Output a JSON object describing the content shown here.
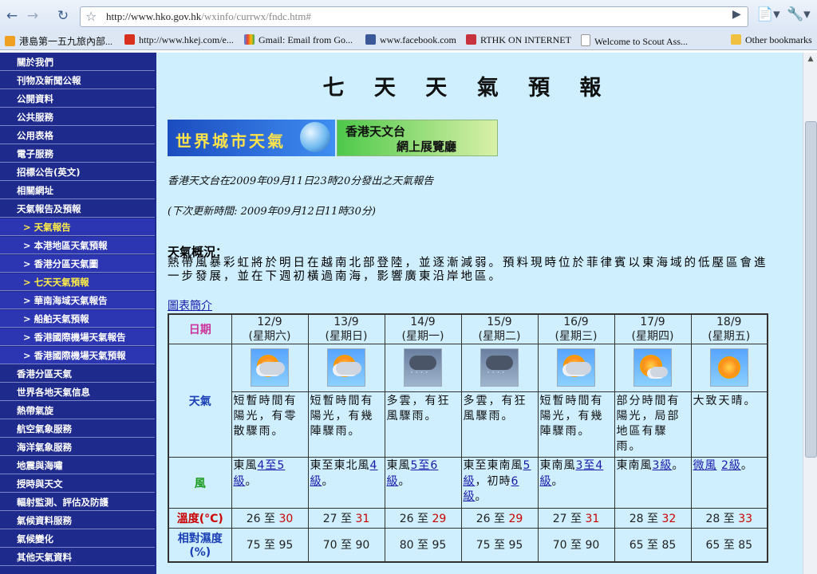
{
  "browser": {
    "url_host": "http://www.hko.gov.hk",
    "url_path": "/wxinfo/currwx/fndc.htm#",
    "bookmarks": [
      "港島第一五九旅內部...",
      "http://www.hkej.com/e...",
      "Gmail: Email from Go...",
      "www.facebook.com",
      "RTHK ON INTERNET",
      "Welcome to Scout Ass...",
      "Other bookmarks"
    ]
  },
  "sidebar": {
    "items": [
      "關於我們",
      "刊物及新聞公報",
      "公開資料",
      "公共服務",
      "公用表格",
      "電子服務",
      "招標公告(英文)",
      "相關網址",
      "天氣報告及預報",
      "> 天氣報告",
      "> 本港地區天氣預報",
      "> 香港分區天氣圖",
      "> 七天天氣預報",
      "> 華南海域天氣報告",
      "> 船舶天氣預報",
      "> 香港國際機場天氣報告",
      "> 香港國際機場天氣預報",
      "香港分區天氣",
      "世界各地天氣信息",
      "熱帶氣旋",
      "航空氣象服務",
      "海洋氣象服務",
      "地震與海嘯",
      "授時與天文",
      "輻射監測、評估及防護",
      "氣候資料服務",
      "氣候變化",
      "其他天氣資料"
    ]
  },
  "main": {
    "title": "七 天 天 氣 預 報",
    "banner_world": "世界城市天氣",
    "banner_hko_line1": "香港天文台",
    "banner_hko_line2": "網上展覽廳",
    "issue_line": "香港天文台在2009年09月11日23時20分發出之天氣報告",
    "next_update": "(下次更新時間: 2009年09月12日11時30分)",
    "overview_heading": "天氣概況：",
    "overview_text": "熱帶風暴彩虹將於明日在越南北部登陸，並逐漸減弱。預料現時位於菲律賓以東海域的低壓區會進一步發展，並在下週初橫過南海，影響廣東沿岸地區。",
    "chart_intro_link": "圖表簡介"
  },
  "table": {
    "labels": {
      "date": "日期",
      "weather": "天氣",
      "wind": "風",
      "temp": "溫度(°C)",
      "humidity": "相對濕度 (%)"
    },
    "days": [
      {
        "date": "12/9",
        "dow": "(星期六)",
        "icon": "sun-cloud-rain-icon",
        "weather": "短暫時間有陽光，有零散驟雨。",
        "wind_pre": "東風",
        "wind_link": "4至5級",
        "wind_post": "。",
        "wind_link2": "",
        "wind_post2": "",
        "tmin": "26",
        "tmax": "30",
        "hmin": "75",
        "hmax": "95"
      },
      {
        "date": "13/9",
        "dow": "(星期日)",
        "icon": "sun-cloud-rain-icon",
        "weather": "短暫時間有陽光，有幾陣驟雨。",
        "wind_pre": "東至東北風",
        "wind_link": "4級",
        "wind_post": "。",
        "wind_link2": "",
        "wind_post2": "",
        "tmin": "27",
        "tmax": "31",
        "hmin": "70",
        "hmax": "90"
      },
      {
        "date": "14/9",
        "dow": "(星期一)",
        "icon": "heavy-rain-icon",
        "weather": "多雲，有狂風驟雨。",
        "wind_pre": "東風",
        "wind_link": "5至6級",
        "wind_post": "。",
        "wind_link2": "",
        "wind_post2": "",
        "tmin": "26",
        "tmax": "29",
        "hmin": "80",
        "hmax": "95"
      },
      {
        "date": "15/9",
        "dow": "(星期二)",
        "icon": "heavy-rain-icon",
        "weather": "多雲，有狂風驟雨。",
        "wind_pre": "東至東南風",
        "wind_link": "5級",
        "wind_post": "，初時",
        "wind_link2": "6級",
        "wind_post2": "。",
        "tmin": "26",
        "tmax": "29",
        "hmin": "75",
        "hmax": "95"
      },
      {
        "date": "16/9",
        "dow": "(星期三)",
        "icon": "sun-cloud-rain-icon",
        "weather": "短暫時間有陽光，有幾陣驟雨。",
        "wind_pre": "東南風",
        "wind_link": "3至4級",
        "wind_post": "。",
        "wind_link2": "",
        "wind_post2": "",
        "tmin": "27",
        "tmax": "31",
        "hmin": "70",
        "hmax": "90"
      },
      {
        "date": "17/9",
        "dow": "(星期四)",
        "icon": "sun-cloud-shower-icon",
        "weather": "部分時間有陽光，局部地區有驟雨。",
        "wind_pre": "東南風",
        "wind_link": "3級",
        "wind_post": "。",
        "wind_link2": "",
        "wind_post2": "",
        "tmin": "28",
        "tmax": "32",
        "hmin": "65",
        "hmax": "85"
      },
      {
        "date": "18/9",
        "dow": "(星期五)",
        "icon": "sunny-icon",
        "weather": "大致天晴。",
        "wind_pre": "",
        "wind_link": "微風",
        "wind_post": " ",
        "wind_link2": "2級",
        "wind_post2": "。",
        "tmin": "28",
        "tmax": "33",
        "hmin": "65",
        "hmax": "85"
      }
    ],
    "to_word": "至"
  },
  "colors": {
    "sidebar_bg": "#1e2a8c",
    "sidebar_sub_bg": "#2d36b2",
    "active_nav": "#ffee44",
    "content_bg": "#cfefff",
    "link": "#1a1aaa",
    "max_temp": "#cc0000",
    "date_label": "#cc3399",
    "weather_label": "#1a3fb5",
    "wind_label": "#1a9a1a",
    "temp_label": "#cc0000",
    "humidity_label": "#1a3fb5"
  }
}
